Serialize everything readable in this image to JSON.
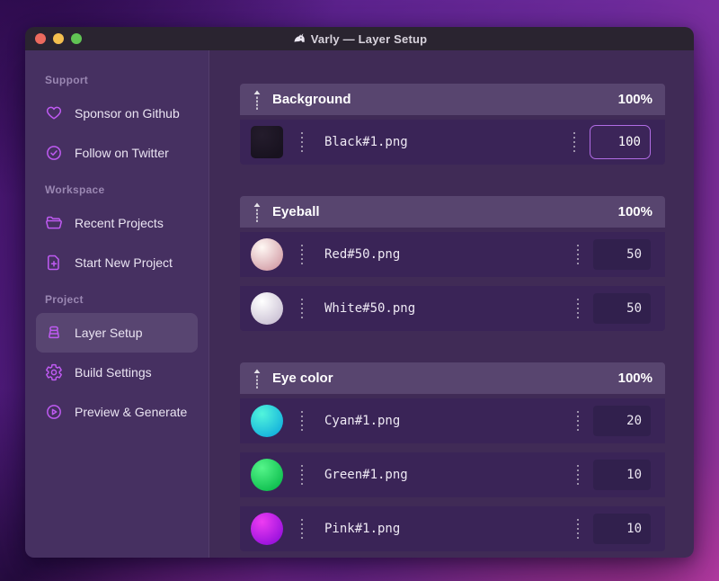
{
  "window": {
    "title": "Varly — Layer Setup",
    "app_icon": "unicorn-icon",
    "traffic_lights": [
      "close",
      "minimize",
      "zoom"
    ]
  },
  "sidebar": {
    "sections": [
      {
        "label": "Support",
        "items": [
          {
            "icon": "heart-icon",
            "label": "Sponsor on Github"
          },
          {
            "icon": "verified-badge-icon",
            "label": "Follow on Twitter"
          }
        ]
      },
      {
        "label": "Workspace",
        "items": [
          {
            "icon": "folder-open-icon",
            "label": "Recent Projects"
          },
          {
            "icon": "file-plus-icon",
            "label": "Start New Project"
          }
        ]
      },
      {
        "label": "Project",
        "items": [
          {
            "icon": "layers-icon",
            "label": "Layer Setup",
            "active": true
          },
          {
            "icon": "gear-icon",
            "label": "Build Settings"
          },
          {
            "icon": "play-circle-icon",
            "label": "Preview & Generate"
          }
        ]
      }
    ]
  },
  "layers": {
    "groups": [
      {
        "name": "Background",
        "weight": "100%",
        "items": [
          {
            "file": "Black#1.png",
            "value": "100",
            "focused": true,
            "thumb_shape": "square",
            "thumb_colors": [
              "#241c2c",
              "#18121f"
            ]
          }
        ]
      },
      {
        "name": "Eyeball",
        "weight": "100%",
        "items": [
          {
            "file": "Red#50.png",
            "value": "50",
            "thumb_shape": "circle",
            "thumb_colors": [
              "#fff8f4",
              "#d6a4ac"
            ]
          },
          {
            "file": "White#50.png",
            "value": "50",
            "thumb_shape": "circle",
            "thumb_colors": [
              "#ffffff",
              "#cdc4d6"
            ]
          }
        ]
      },
      {
        "name": "Eye color",
        "weight": "100%",
        "items": [
          {
            "file": "Cyan#1.png",
            "value": "20",
            "thumb_shape": "circle",
            "thumb_colors": [
              "#52f5dc",
              "#16b4dc"
            ]
          },
          {
            "file": "Green#1.png",
            "value": "10",
            "thumb_shape": "circle",
            "thumb_colors": [
              "#55f58a",
              "#10c050"
            ]
          },
          {
            "file": "Pink#1.png",
            "value": "10",
            "thumb_shape": "circle",
            "thumb_colors": [
              "#ee3cf2",
              "#9a12dd"
            ]
          }
        ]
      }
    ]
  },
  "colors": {
    "accent": "#bf5af2",
    "focus_border": "#b16ce4",
    "sidebar_bg": "#463061",
    "main_bg": "#402b56",
    "group_header_bg": "#58456f",
    "row_bg": "#3a2457",
    "titlebar_bg": "#2a2430"
  }
}
